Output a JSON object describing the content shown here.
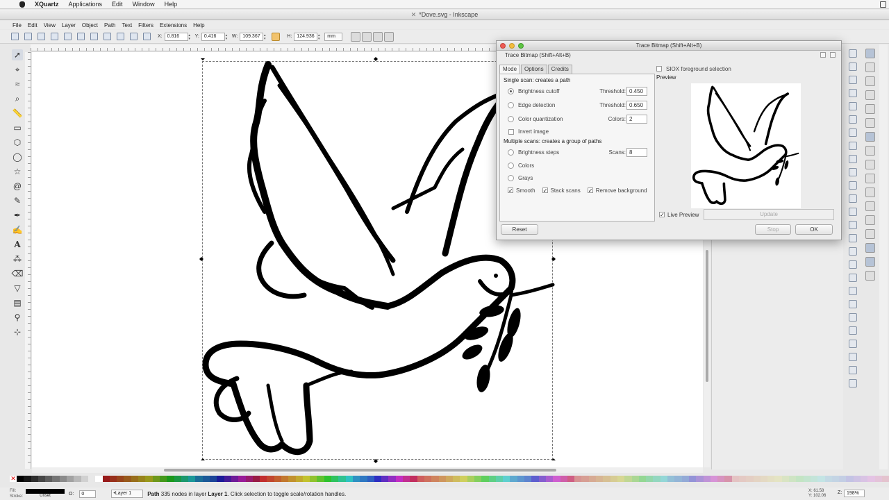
{
  "mac_menubar": {
    "app": "XQuartz",
    "items": [
      "Applications",
      "Edit",
      "Window",
      "Help"
    ]
  },
  "window_title": "*Dove.svg - Inkscape",
  "menu": [
    "File",
    "Edit",
    "View",
    "Layer",
    "Object",
    "Path",
    "Text",
    "Filters",
    "Extensions",
    "Help"
  ],
  "controls": {
    "x_label": "X:",
    "x_value": "0.816",
    "y_label": "Y:",
    "y_value": "0.416",
    "w_label": "W:",
    "w_value": "109.367",
    "h_label": "H:",
    "h_value": "124.936",
    "unit": "mm"
  },
  "dialog": {
    "title": "Trace Bitmap (Shift+Alt+B)",
    "subtitle": "Trace Bitmap (Shift+Alt+B)",
    "tabs": [
      "Mode",
      "Options",
      "Credits"
    ],
    "single_scan_title": "Single scan: creates a path",
    "brightness_cutoff": {
      "label": "Brightness cutoff",
      "param": "Threshold:",
      "value": "0.450"
    },
    "edge_detection": {
      "label": "Edge detection",
      "param": "Threshold:",
      "value": "0.650"
    },
    "color_quantization": {
      "label": "Color quantization",
      "param": "Colors:",
      "value": "2"
    },
    "invert_image": "Invert image",
    "multiple_scans_title": "Multiple scans: creates a group of paths",
    "brightness_steps": {
      "label": "Brightness steps",
      "param": "Scans:",
      "value": "8"
    },
    "colors": "Colors",
    "grays": "Grays",
    "smooth": "Smooth",
    "stack_scans": "Stack scans",
    "remove_background": "Remove background",
    "siox": "SIOX foreground selection",
    "preview_label": "Preview",
    "live_preview": "Live Preview",
    "update": "Update",
    "reset": "Reset",
    "stop": "Stop",
    "ok": "OK"
  },
  "status": {
    "fill_label": "Fill:",
    "stroke_label": "Stroke:",
    "stroke_value": "Unset",
    "opacity_label": "O:",
    "opacity": "0",
    "layer": "•Layer 1",
    "message_bold": "Path",
    "message": "335 nodes in layer",
    "message_layer": "Layer 1",
    "message_tail": ". Click selection to toggle scale/rotation handles.",
    "x_coord": "X: 61.58",
    "y_coord": "Y: 102.06",
    "zoom_label": "Z:",
    "zoom": "198%"
  },
  "colors": {
    "accent": "#b6c3d6",
    "close": "#ee5b53",
    "minimize": "#f3bd3e",
    "maximize": "#5ec443"
  }
}
